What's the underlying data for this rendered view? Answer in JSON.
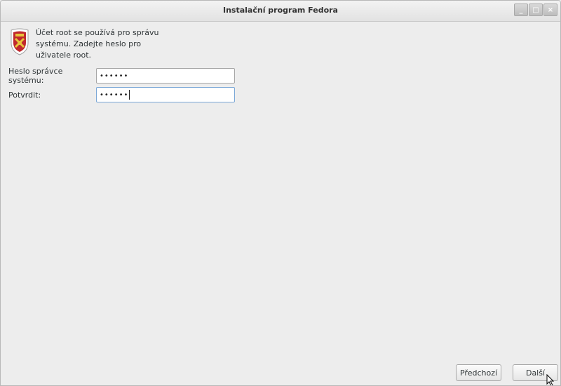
{
  "window": {
    "title": "Instalační program Fedora"
  },
  "intro": {
    "text": "Účet root se používá pro správu systému. Zadejte heslo pro uživatele root.",
    "icon": "root-shield-icon"
  },
  "form": {
    "password_label": "Heslo správce systému:",
    "password_value": "••••••",
    "confirm_label": "Potvrdit:",
    "confirm_value": "••••••"
  },
  "buttons": {
    "back_label": "Předchozí",
    "next_label": "Další"
  },
  "colors": {
    "background": "#ededed",
    "focus_border": "#7aa7d6",
    "icon_red": "#c0282d",
    "icon_gold": "#e8c43a"
  }
}
